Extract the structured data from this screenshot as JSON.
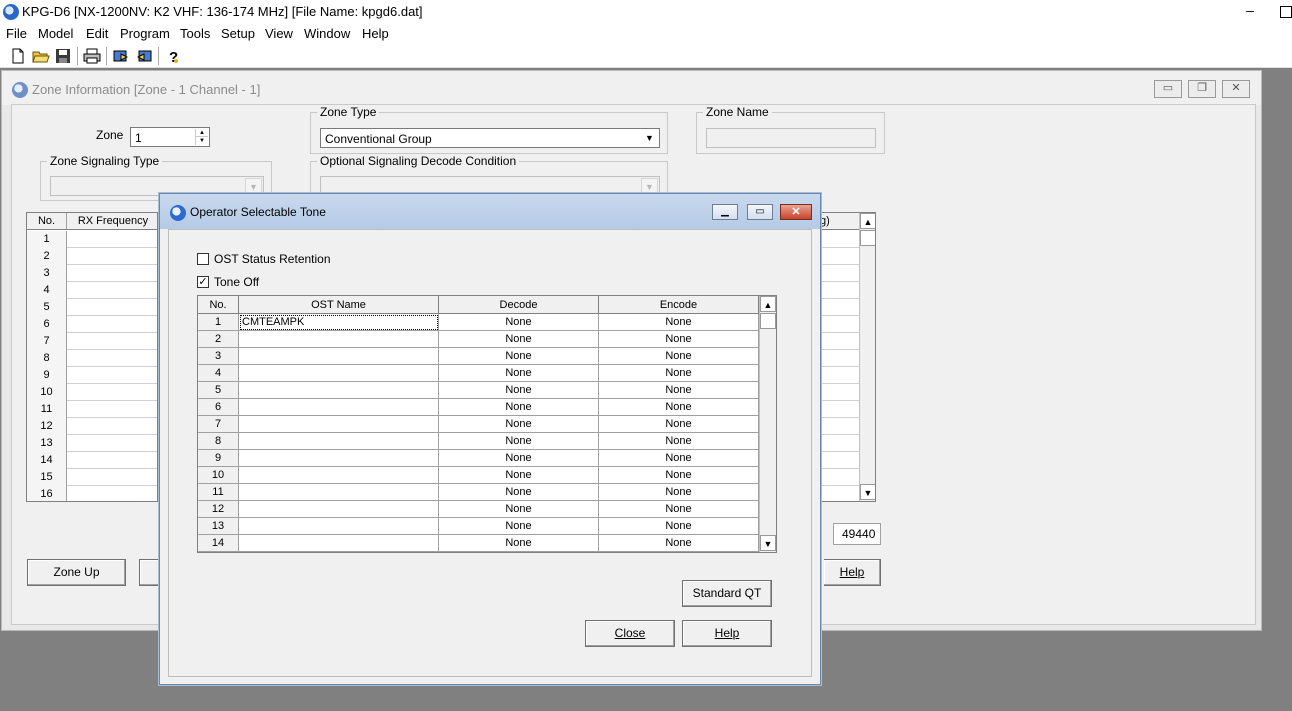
{
  "app": {
    "title": "KPG-D6 [NX-1200NV: K2 VHF: 136-174 MHz] [File Name: kpgd6.dat]",
    "menu": [
      "File",
      "Model",
      "Edit",
      "Program",
      "Tools",
      "Setup",
      "View",
      "Window",
      "Help"
    ]
  },
  "zone_window": {
    "title": "Zone Information [Zone - 1   Channel  -  1]",
    "zone_label": "Zone",
    "zone_value": "1",
    "zone_type_label": "Zone Type",
    "zone_type_value": "Conventional Group",
    "zone_name_label": "Zone Name",
    "zone_name_value": "",
    "zone_signaling_label": "Zone Signaling Type",
    "optional_signaling_label": "Optional Signaling Decode Condition",
    "grid_headers": {
      "no": "No.",
      "rx": "RX Frequency",
      "right_partial": "g)"
    },
    "grid_rows": [
      "1",
      "2",
      "3",
      "4",
      "5",
      "6",
      "7",
      "8",
      "9",
      "10",
      "11",
      "12",
      "13",
      "14",
      "15",
      "16"
    ],
    "value_box": "49440",
    "zone_up_label": "Zone Up",
    "zone_up_underline": "U",
    "help_label": "Help",
    "help_underline": "H"
  },
  "dialog": {
    "title": "Operator Selectable Tone",
    "ost_status_retention_label": "OST Status Retention",
    "ost_status_retention_checked": false,
    "tone_off_label": "Tone Off",
    "tone_off_checked": true,
    "headers": {
      "no": "No.",
      "name": "OST Name",
      "decode": "Decode",
      "encode": "Encode"
    },
    "rows": [
      {
        "no": "1",
        "name": "CMTEAMPK",
        "decode": "None",
        "encode": "None"
      },
      {
        "no": "2",
        "name": "",
        "decode": "None",
        "encode": "None"
      },
      {
        "no": "3",
        "name": "",
        "decode": "None",
        "encode": "None"
      },
      {
        "no": "4",
        "name": "",
        "decode": "None",
        "encode": "None"
      },
      {
        "no": "5",
        "name": "",
        "decode": "None",
        "encode": "None"
      },
      {
        "no": "6",
        "name": "",
        "decode": "None",
        "encode": "None"
      },
      {
        "no": "7",
        "name": "",
        "decode": "None",
        "encode": "None"
      },
      {
        "no": "8",
        "name": "",
        "decode": "None",
        "encode": "None"
      },
      {
        "no": "9",
        "name": "",
        "decode": "None",
        "encode": "None"
      },
      {
        "no": "10",
        "name": "",
        "decode": "None",
        "encode": "None"
      },
      {
        "no": "11",
        "name": "",
        "decode": "None",
        "encode": "None"
      },
      {
        "no": "12",
        "name": "",
        "decode": "None",
        "encode": "None"
      },
      {
        "no": "13",
        "name": "",
        "decode": "None",
        "encode": "None"
      },
      {
        "no": "14",
        "name": "",
        "decode": "None",
        "encode": "None"
      }
    ],
    "standard_qt_label": "Standard QT",
    "close_label": "Close",
    "close_underline": "C",
    "help_label": "Help",
    "help_underline": "H"
  }
}
